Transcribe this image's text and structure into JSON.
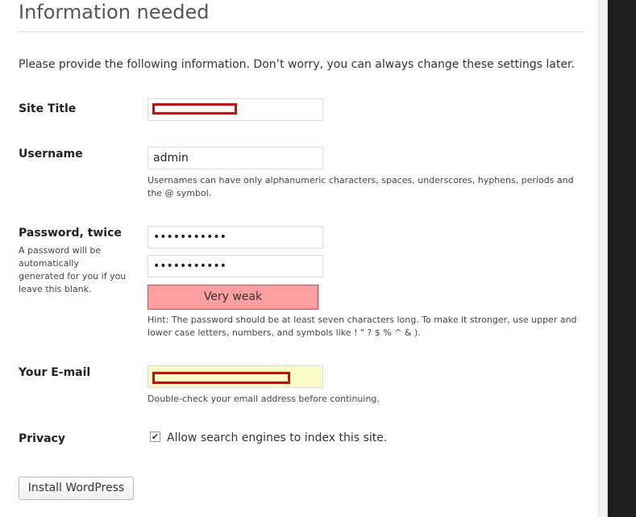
{
  "header": {
    "title": "Information needed"
  },
  "intro": "Please provide the following information. Don’t worry, you can always change these settings later.",
  "fields": {
    "site_title": {
      "label": "Site Title",
      "value": ""
    },
    "username": {
      "label": "Username",
      "value": "admin",
      "description": "Usernames can have only alphanumeric characters, spaces, underscores, hyphens, periods and the @ symbol."
    },
    "password": {
      "label": "Password, twice",
      "sub_description": "A password will be automatically generated for you if you leave this blank.",
      "value1": "•••••••••••",
      "value2": "•••••••••••",
      "strength": "Very weak",
      "hint": "Hint: The password should be at least seven characters long. To make it stronger, use upper and lower case letters, numbers, and symbols like ! \" ? $ % ^ & )."
    },
    "email": {
      "label": "Your E-mail",
      "value": "",
      "description": "Double-check your email address before continuing."
    },
    "privacy": {
      "label": "Privacy",
      "checkbox_label": "Allow search engines to index this site.",
      "checked": true
    }
  },
  "install_button": "Install WordPress",
  "colors": {
    "strength_bg": "#ffa0a0",
    "strength_border": "#f04040",
    "email_bg": "#fafcc6",
    "redaction": "#e00000"
  }
}
